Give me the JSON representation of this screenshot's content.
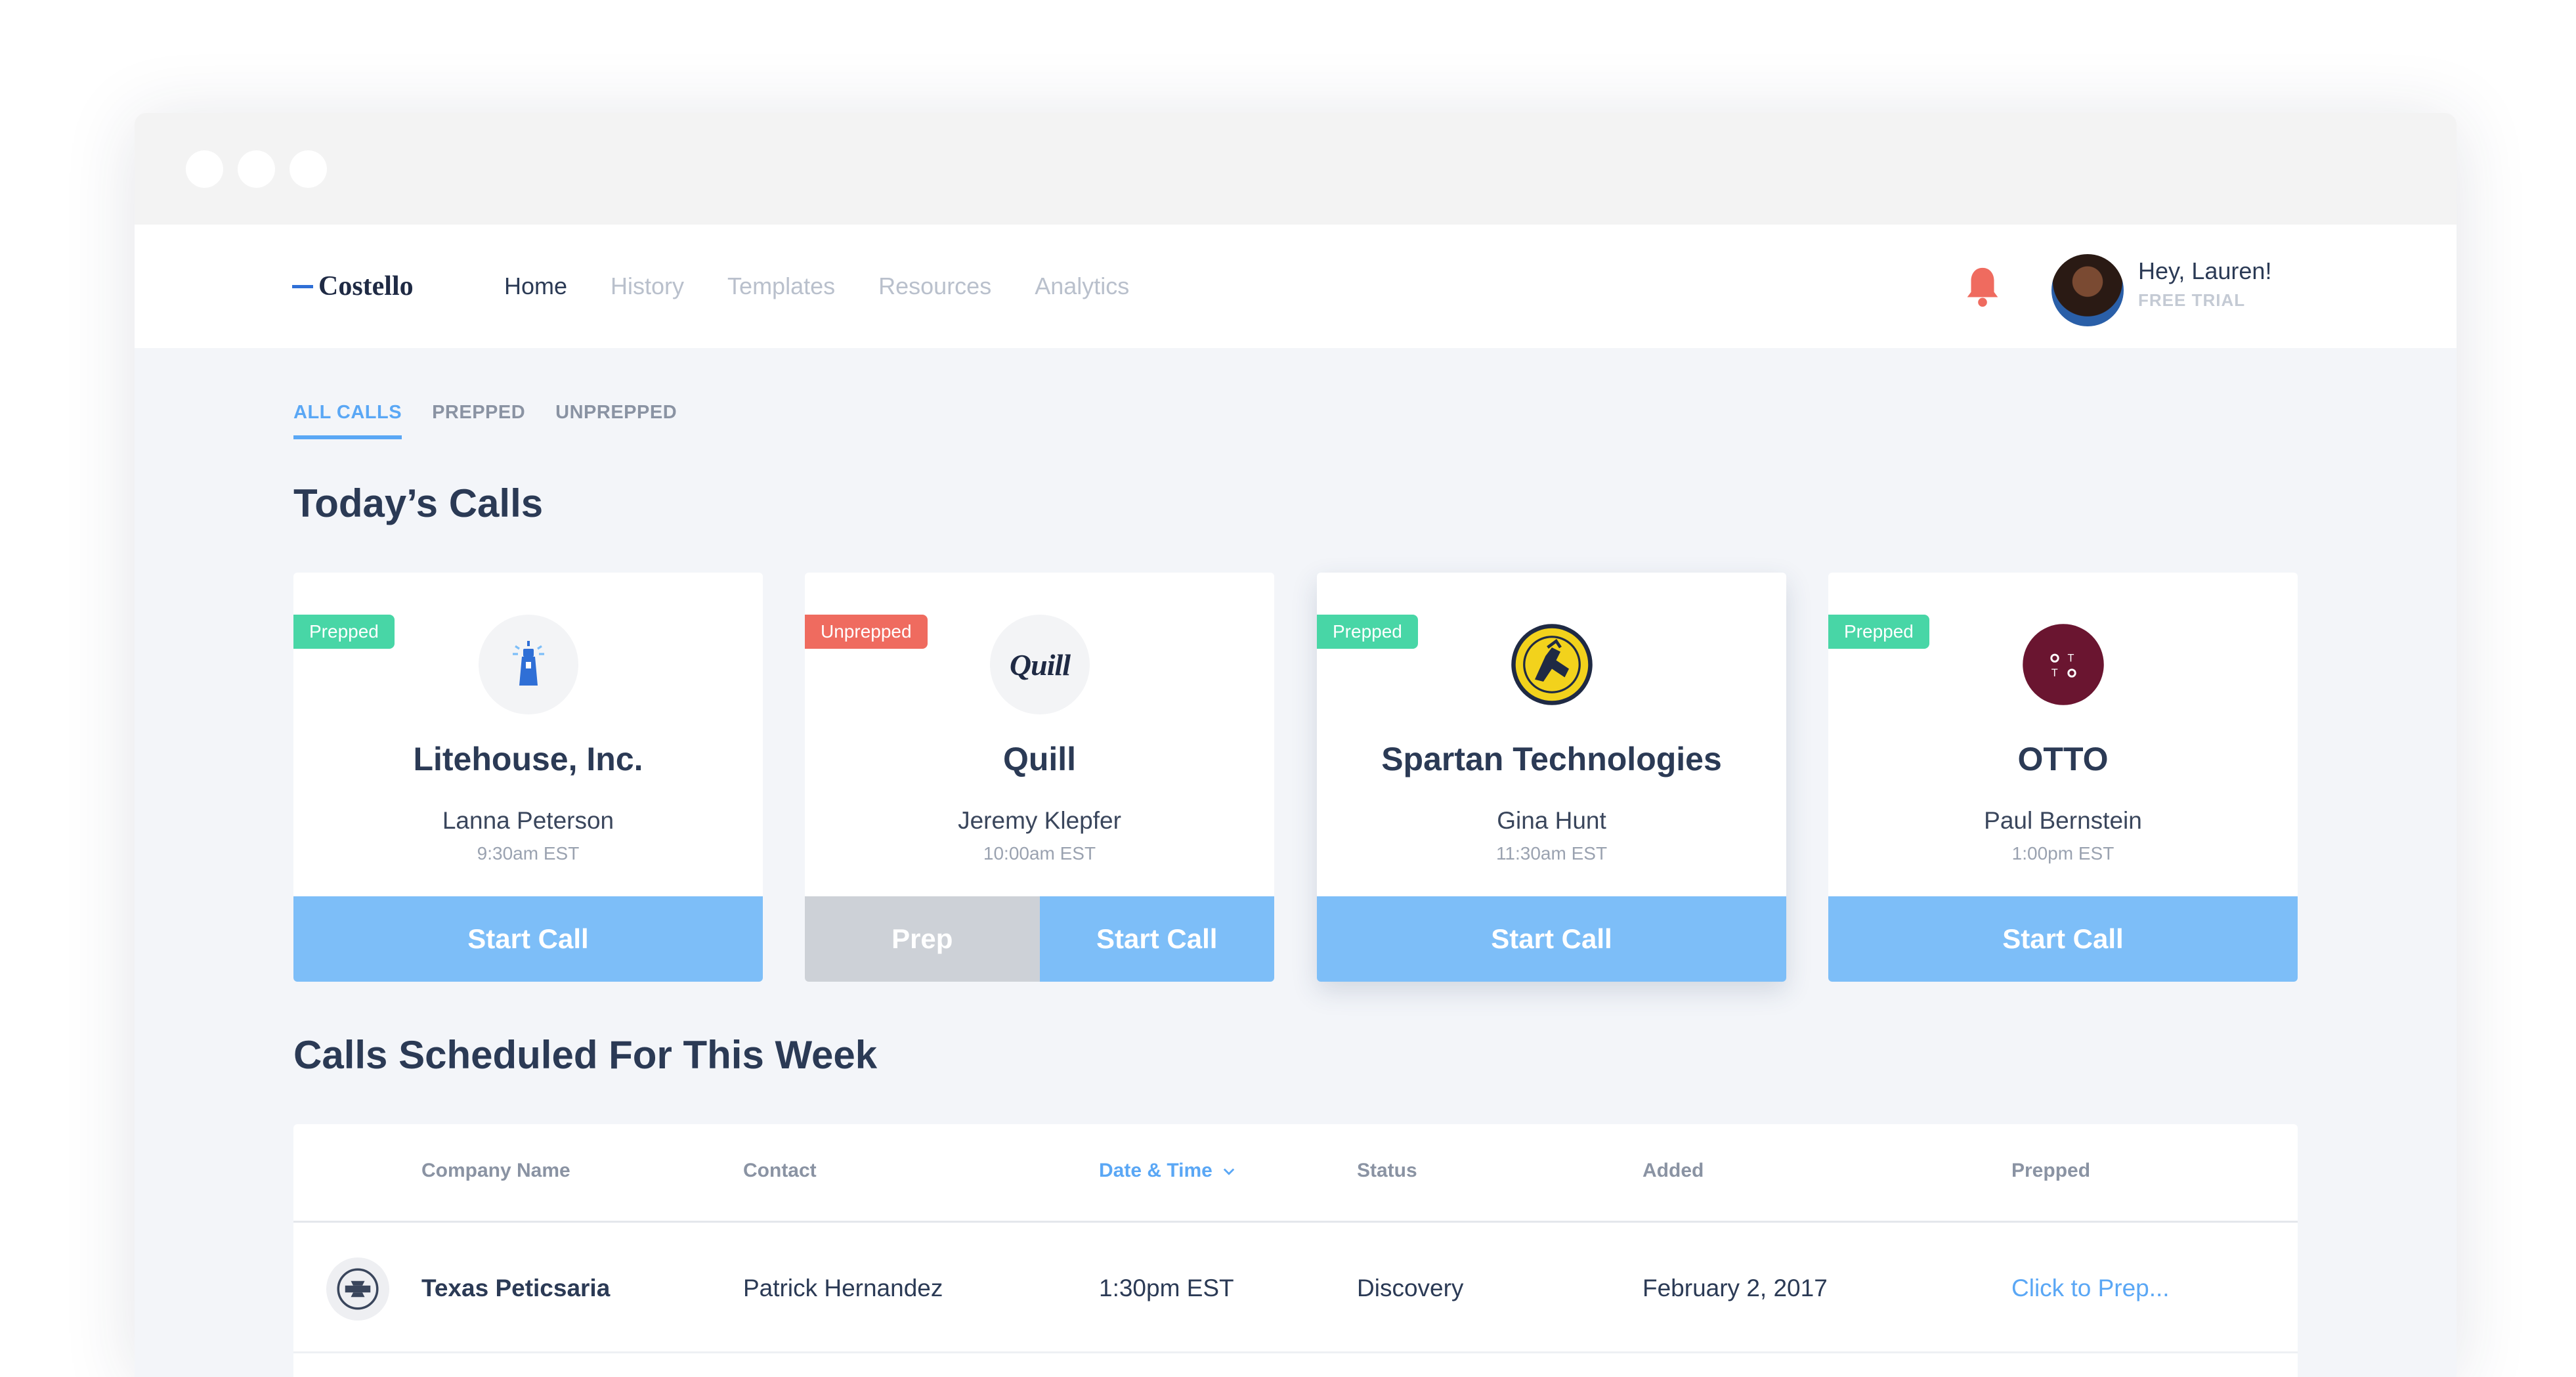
{
  "brand": "Costello",
  "nav": {
    "items": [
      "Home",
      "History",
      "Templates",
      "Resources",
      "Analytics"
    ],
    "active": "Home"
  },
  "user": {
    "greeting": "Hey, Lauren!",
    "plan": "FREE TRIAL"
  },
  "filter_tabs": [
    "ALL CALLS",
    "PREPPED",
    "UNPREPPED"
  ],
  "todays_title": "Today’s Calls",
  "cards": [
    {
      "status": "Prepped",
      "company": "Litehouse, Inc.",
      "contact": "Lanna Peterson",
      "time": "9:30am EST",
      "buttons": [
        "Start Call"
      ],
      "logo_icon": "lighthouse-icon"
    },
    {
      "status": "Unprepped",
      "company": "Quill",
      "contact": "Jeremy Klepfer",
      "time": "10:00am EST",
      "buttons": [
        "Prep",
        "Start Call"
      ],
      "logo_icon": "quill-wordmark",
      "logo_text": "Quill"
    },
    {
      "status": "Prepped",
      "company": "Spartan Technologies",
      "contact": "Gina Hunt",
      "time": "11:30am EST",
      "buttons": [
        "Start Call"
      ],
      "logo_icon": "spartan-emblem-icon"
    },
    {
      "status": "Prepped",
      "company": "OTTO",
      "contact": "Paul Bernstein",
      "time": "1:00pm EST",
      "buttons": [
        "Start Call"
      ],
      "logo_icon": "otto-dots-icon"
    }
  ],
  "week_title": "Calls Scheduled For This Week",
  "table": {
    "columns": [
      "Company Name",
      "Contact",
      "Date & Time",
      "Status",
      "Added",
      "Prepped"
    ],
    "sorted_column": "Date & Time",
    "rows": [
      {
        "company": "Texas Peticsaria",
        "contact": "Patrick Hernandez",
        "datetime": "1:30pm EST",
        "status": "Discovery",
        "added": "February 2, 2017",
        "prepped": "Click to Prep..."
      }
    ]
  },
  "colors": {
    "accent": "#5aa7f5",
    "button": "#7dbef8",
    "prepped": "#48d6a6",
    "unprepped": "#ef6b5f",
    "bell": "#ef6b5f",
    "heading": "#2b3a55"
  }
}
